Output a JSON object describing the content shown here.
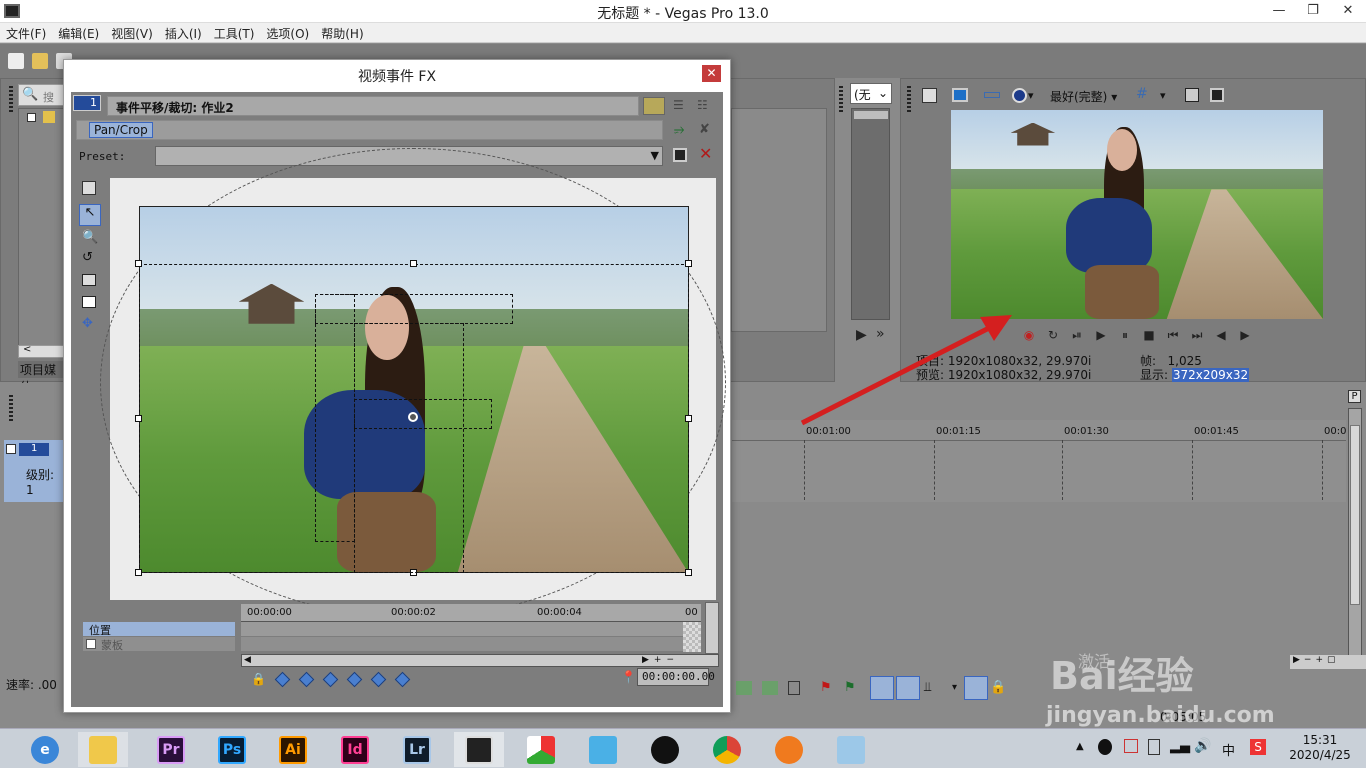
{
  "window": {
    "title": "无标题 * - Vegas Pro 13.0"
  },
  "menu": [
    "文件(F)",
    "编辑(E)",
    "视图(V)",
    "插入(I)",
    "工具(T)",
    "选项(O)",
    "帮助(H)"
  ],
  "left_panel": {
    "search_placeholder": "搜索",
    "tab_label": "项目媒体",
    "level_label": "级别: 1",
    "rate_label": "速率: .00",
    "track_number": "1"
  },
  "dialog": {
    "title": "视频事件 FX",
    "track_number": "1",
    "event_label": "事件平移/裁切: 作业2",
    "plugin": "Pan/Crop",
    "preset_label": "Preset:",
    "preset_value": "",
    "timeline_marks": [
      "00:00:00",
      "00:00:02",
      "00:00:04",
      "00"
    ],
    "params": [
      "位置",
      "蒙板"
    ],
    "timecode": "00:00:00.00"
  },
  "middle_panel": {
    "combo": "(无"
  },
  "preview": {
    "quality": "最好(完整)",
    "project_label": "项目:",
    "project_value": "1920x1080x32, 29.970i",
    "preview_label": "预览:",
    "preview_value": "1920x1080x32, 29.970i",
    "frame_label": "帧:",
    "frame_value": "1,025",
    "display_label": "显示:",
    "display_value": "372x209x32"
  },
  "timeline": {
    "marks": [
      "00:01:00",
      "00:01:15",
      "00:01:30",
      "00:01:45",
      "00:0"
    ],
    "time_status": "0:05:05"
  },
  "watermark": {
    "logo_text": "Bai经验",
    "url": "jingyan.baidu.com",
    "activate": "激活"
  },
  "taskbar": {
    "apps": [
      "Pr",
      "Ps",
      "Ai",
      "Id",
      "Lr"
    ],
    "ime": "中",
    "time": "15:31",
    "date": "2020/4/25"
  },
  "colors": {
    "accent_red": "#d62020",
    "arrow_red": "#d41f1f"
  }
}
